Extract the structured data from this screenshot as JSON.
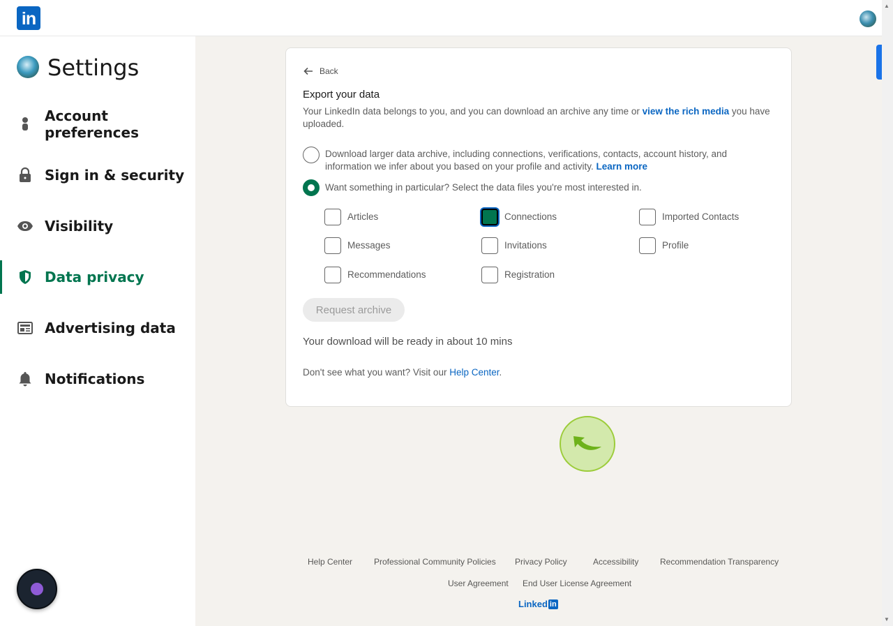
{
  "app": {
    "logo_text": "in"
  },
  "sidebar": {
    "title": "Settings",
    "items": [
      {
        "label": "Account preferences",
        "icon": "person-icon"
      },
      {
        "label": "Sign in & security",
        "icon": "lock-icon"
      },
      {
        "label": "Visibility",
        "icon": "eye-icon"
      },
      {
        "label": "Data privacy",
        "icon": "shield-icon",
        "active": true
      },
      {
        "label": "Advertising data",
        "icon": "newspaper-icon"
      },
      {
        "label": "Notifications",
        "icon": "bell-icon"
      }
    ]
  },
  "card": {
    "back_label": "Back",
    "title": "Export your data",
    "desc_pre": "Your LinkedIn data belongs to you, and you can download an archive any time or ",
    "desc_link": "view the rich media",
    "desc_post": " you have uploaded.",
    "option1_text": "Download larger data archive, including connections, verifications, contacts, account history, and information we infer about you based on your profile and activity. ",
    "option1_link": "Learn more",
    "option2_text": "Want something in particular? Select the data files you're most interested in.",
    "checkboxes": {
      "articles": "Articles",
      "connections": "Connections",
      "imported_contacts": "Imported Contacts",
      "messages": "Messages",
      "invitations": "Invitations",
      "profile": "Profile",
      "recommendations": "Recommendations",
      "registration": "Registration"
    },
    "request_button": "Request archive",
    "ready_text": "Your download will be ready in about 10 mins",
    "help_pre": "Don't see what you want? Visit our ",
    "help_link": "Help Center",
    "help_post": "."
  },
  "footer": {
    "links": {
      "help_center": "Help Center",
      "community_policies": "Professional Community Policies",
      "privacy_policy": "Privacy Policy",
      "accessibility": "Accessibility",
      "recommendation_transparency": "Recommendation Transparency",
      "user_agreement": "User Agreement",
      "eula": "End User License Agreement"
    },
    "brand_text": "Linked",
    "brand_box": "in"
  },
  "colors": {
    "accent_green": "#01754f",
    "brand_blue": "#0a66c2"
  }
}
